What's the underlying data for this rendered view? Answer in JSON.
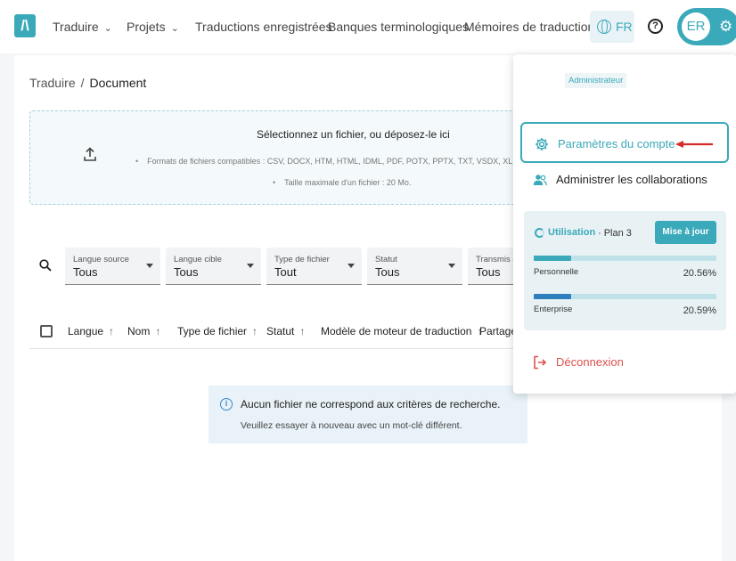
{
  "nav": {
    "logo": "/\\",
    "items": [
      {
        "label": "Traduire",
        "dropdown": true
      },
      {
        "label": "Projets",
        "dropdown": true
      },
      {
        "label": "Traductions enregistrées",
        "dropdown": false
      },
      {
        "label": "Banques terminologiques",
        "dropdown": false
      },
      {
        "label": "Mémoires de traduction",
        "dropdown": false
      }
    ],
    "language": "FR",
    "user_initials": "ER"
  },
  "breadcrumb": {
    "parent": "Traduire",
    "separator": "/",
    "current": "Document"
  },
  "upload": {
    "title": "Sélectionnez un fichier, ou déposez-le ici",
    "formats": "Formats de fichiers compatibles : CSV, DOCX, HTM, HTML, IDML, PDF, POTX, PPTX, TXT, VSDX, XLF, XLIFF, X",
    "max_size": "Taille maximale d'un fichier : 20 Mo."
  },
  "filters": [
    {
      "label": "Langue source",
      "value": "Tous"
    },
    {
      "label": "Langue cible",
      "value": "Tous"
    },
    {
      "label": "Type de fichier",
      "value": "Tout"
    },
    {
      "label": "Statut",
      "value": "Tous"
    },
    {
      "label": "Transmis à",
      "value": "Tous"
    }
  ],
  "table": {
    "columns": [
      "Langue",
      "Nom",
      "Type de fichier",
      "Statut",
      "Modèle de moteur de traduction",
      "Partagé"
    ]
  },
  "empty_state": {
    "title": "Aucun fichier ne correspond aux critères de recherche.",
    "subtitle": "Veuillez essayer à nouveau avec un mot-clé différent."
  },
  "account_menu": {
    "role": "Administrateur",
    "settings_label": "Paramètres du compte",
    "collab_label": "Administrer les collaborations",
    "usage": {
      "title": "Utilisation",
      "plan": "· Plan 3",
      "upgrade_label": "Mise à jour",
      "bars": [
        {
          "name": "Personnelle",
          "percent_text": "20.56%",
          "fraction": 0.2056,
          "color": "#3aa9b9"
        },
        {
          "name": "Enterprise",
          "percent_text": "20.59%",
          "fraction": 0.2059,
          "color": "#2f7fbf"
        }
      ]
    },
    "logout_label": "Déconnexion"
  },
  "colors": {
    "accent": "#3aa9b9",
    "danger": "#d9534f",
    "arrow": "#d62b2b"
  }
}
